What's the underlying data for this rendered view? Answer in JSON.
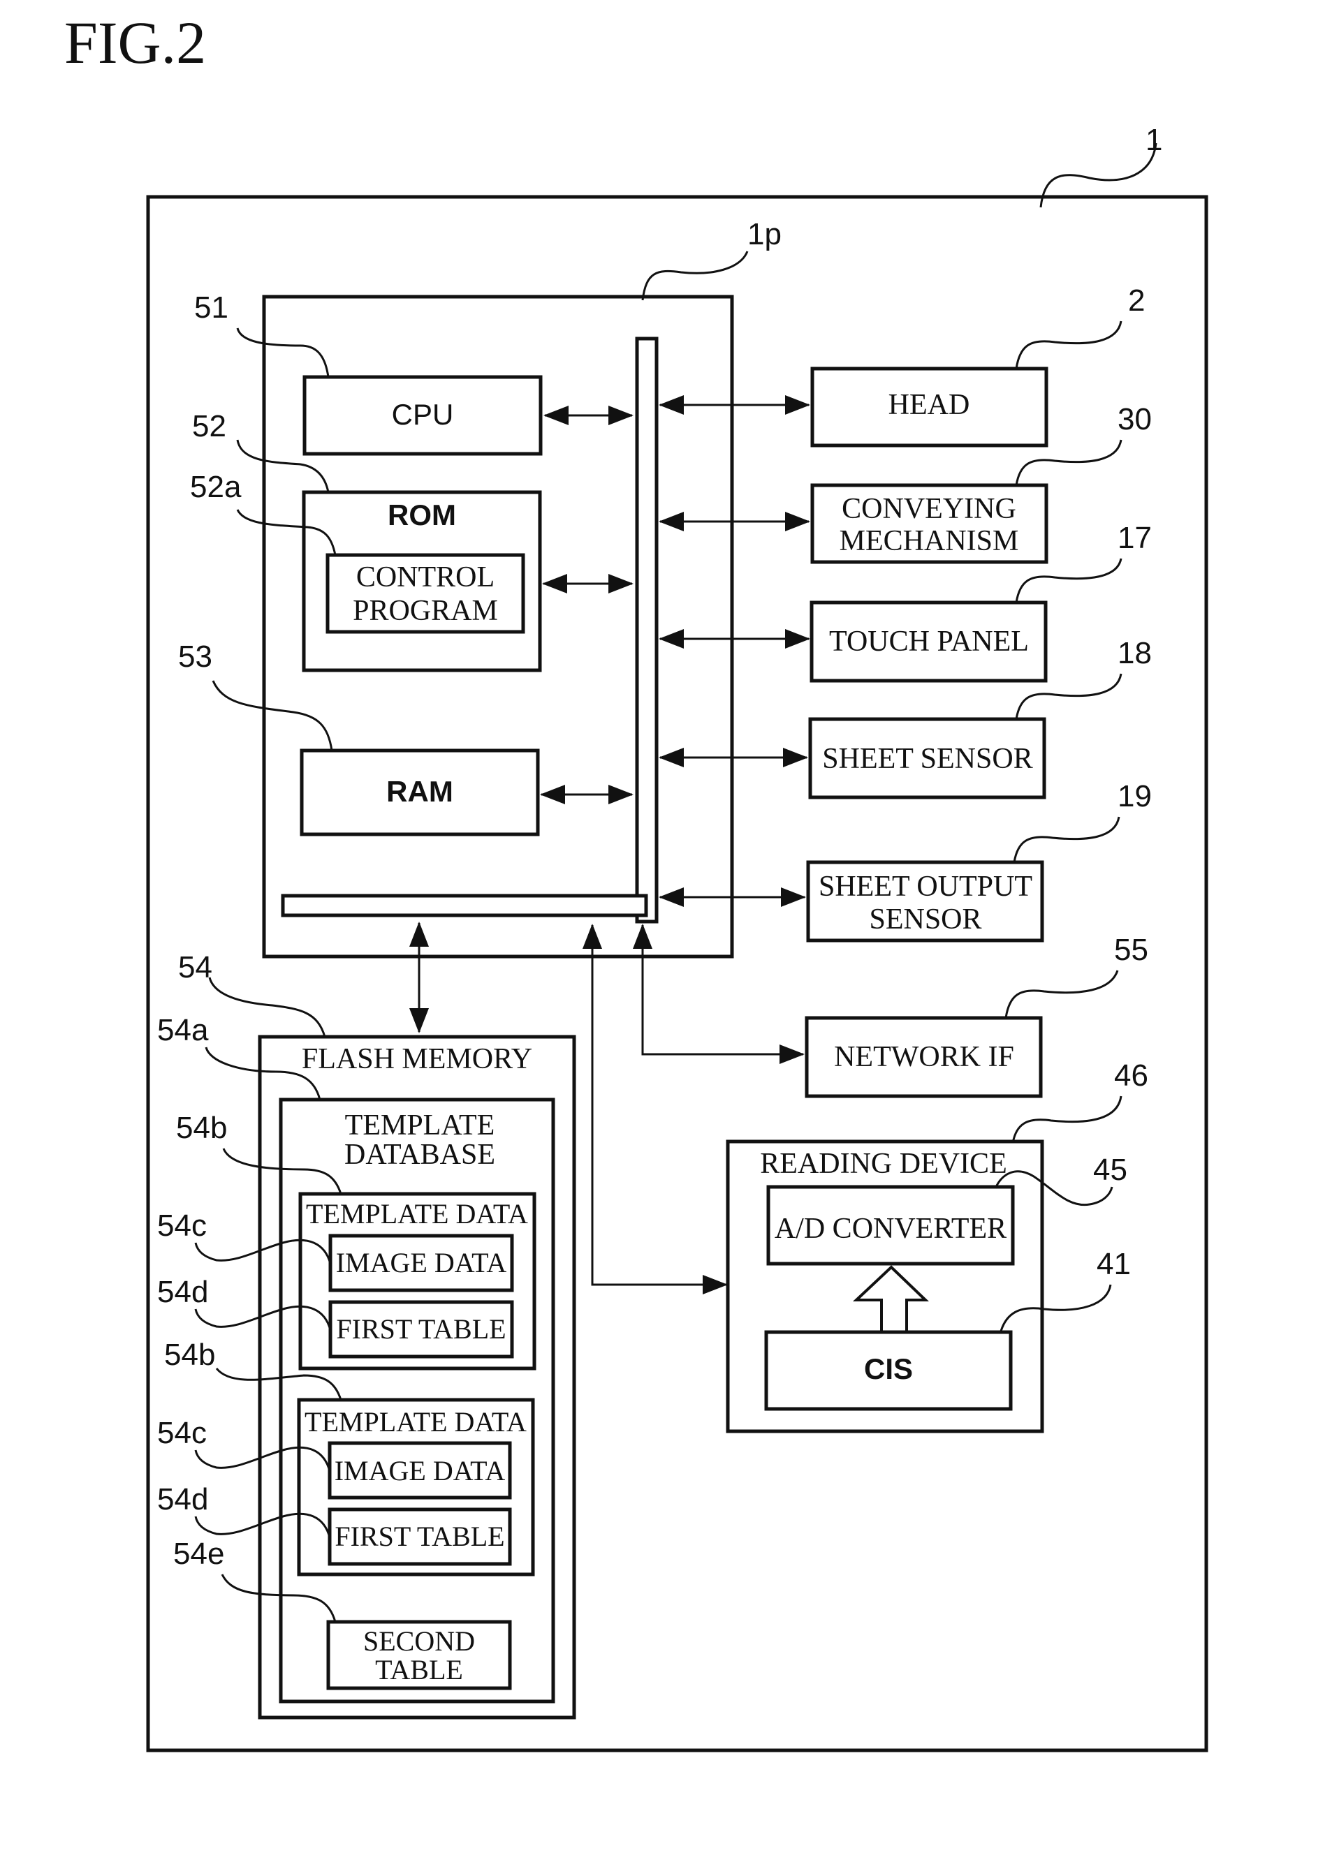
{
  "figure_title": "FIG.2",
  "refs": {
    "device": "1",
    "controller": "1p",
    "cpu": "51",
    "rom": "52",
    "control_program": "52a",
    "ram": "53",
    "flash": "54",
    "template_db": "54a",
    "template_data": "54b",
    "image_data": "54c",
    "first_table": "54d",
    "second_table": "54e",
    "head": "2",
    "conveying": "30",
    "touch_panel": "17",
    "sheet_sensor": "18",
    "sheet_output_sensor": "19",
    "network_if": "55",
    "reading_device": "46",
    "ad_converter": "45",
    "cis": "41"
  },
  "blocks": {
    "cpu": "CPU",
    "rom": "ROM",
    "control_program": [
      "CONTROL",
      "PROGRAM"
    ],
    "ram": "RAM",
    "head": "HEAD",
    "conveying": [
      "CONVEYING",
      "MECHANISM"
    ],
    "touch_panel": "TOUCH PANEL",
    "sheet_sensor": "SHEET SENSOR",
    "sheet_output_sensor": [
      "SHEET OUTPUT",
      "SENSOR"
    ],
    "network_if": "NETWORK IF",
    "flash": "FLASH MEMORY",
    "template_db": [
      "TEMPLATE",
      "DATABASE"
    ],
    "template_data": "TEMPLATE DATA",
    "image_data": "IMAGE DATA",
    "first_table": "FIRST TABLE",
    "second_table": [
      "SECOND",
      "TABLE"
    ],
    "reading_device": "READING DEVICE",
    "ad_converter": "A/D CONVERTER",
    "cis": "CIS"
  }
}
